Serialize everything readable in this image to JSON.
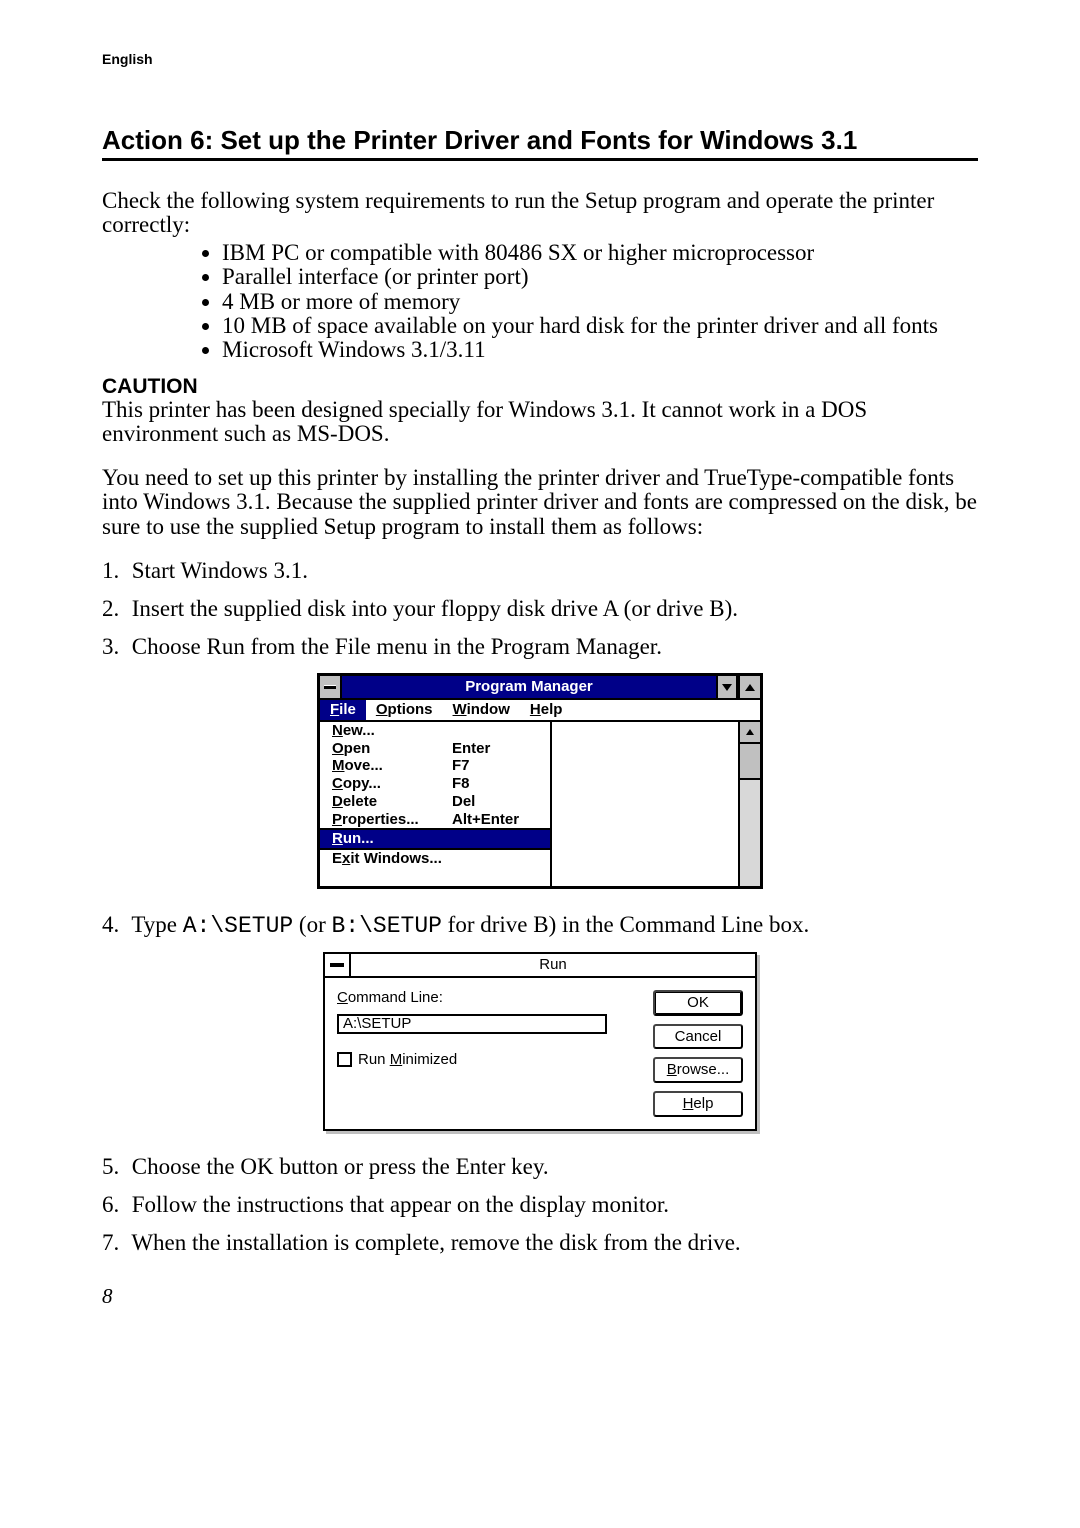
{
  "header": "English",
  "title": "Action 6: Set up the Printer Driver and Fonts for Windows 3.1",
  "intro": "Check the following system requirements to run the Setup program and operate the printer correctly:",
  "bullets": [
    "IBM PC or compatible with 80486 SX or higher microprocessor",
    "Parallel interface (or printer port)",
    "4 MB or more of  memory",
    "10 MB of space available on your hard disk for the printer driver and all fonts",
    "Microsoft Windows 3.1/3.11"
  ],
  "caution_label": "CAUTION",
  "caution_text": "This printer has been designed specially for Windows 3.1. It cannot work in a DOS environment such as MS-DOS.",
  "para2": "You need to set up this printer by installing the printer driver and TrueType-compatible fonts into Windows 3.1. Because the supplied printer driver and fonts are compressed on the disk, be sure to use the supplied Setup program to install them as follows:",
  "steps_top": [
    "Start Windows 3.1.",
    "Insert the supplied disk into your floppy disk drive A (or drive B).",
    "Choose Run from the File menu in the Program Manager."
  ],
  "pm": {
    "title": "Program Manager",
    "menus": [
      "File",
      "Options",
      "Window",
      "Help"
    ],
    "items": [
      {
        "label": "New...",
        "accel": "",
        "sel": false,
        "sepTop": false
      },
      {
        "label": "Open",
        "accel": "Enter",
        "sel": false,
        "sepTop": false
      },
      {
        "label": "Move...",
        "accel": "F7",
        "sel": false,
        "sepTop": false
      },
      {
        "label": "Copy...",
        "accel": "F8",
        "sel": false,
        "sepTop": false
      },
      {
        "label": "Delete",
        "accel": "Del",
        "sel": false,
        "sepTop": false
      },
      {
        "label": "Properties...",
        "accel": "Alt+Enter",
        "sel": false,
        "sepTop": false
      },
      {
        "label": "Run...",
        "accel": "",
        "sel": true,
        "sepTop": true
      },
      {
        "label": "Exit Windows...",
        "accel": "",
        "sel": false,
        "sepTop": true
      }
    ]
  },
  "step4_pre": "Type ",
  "step4_code1": "A:\\SETUP",
  "step4_mid": " (or ",
  "step4_code2": "B:\\SETUP",
  "step4_post": " for drive B) in the Command Line box.",
  "run": {
    "title": "Run",
    "cmd_label": "Command Line:",
    "cmd_value": "A:\\SETUP",
    "minimized": "Run Minimized",
    "buttons": [
      "OK",
      "Cancel",
      "Browse...",
      "Help"
    ]
  },
  "steps_bottom": [
    "Choose the OK button or press the Enter key.",
    "Follow the instructions that appear on the display monitor.",
    "When the installation is complete, remove the disk from the drive."
  ],
  "pagenum": "8"
}
